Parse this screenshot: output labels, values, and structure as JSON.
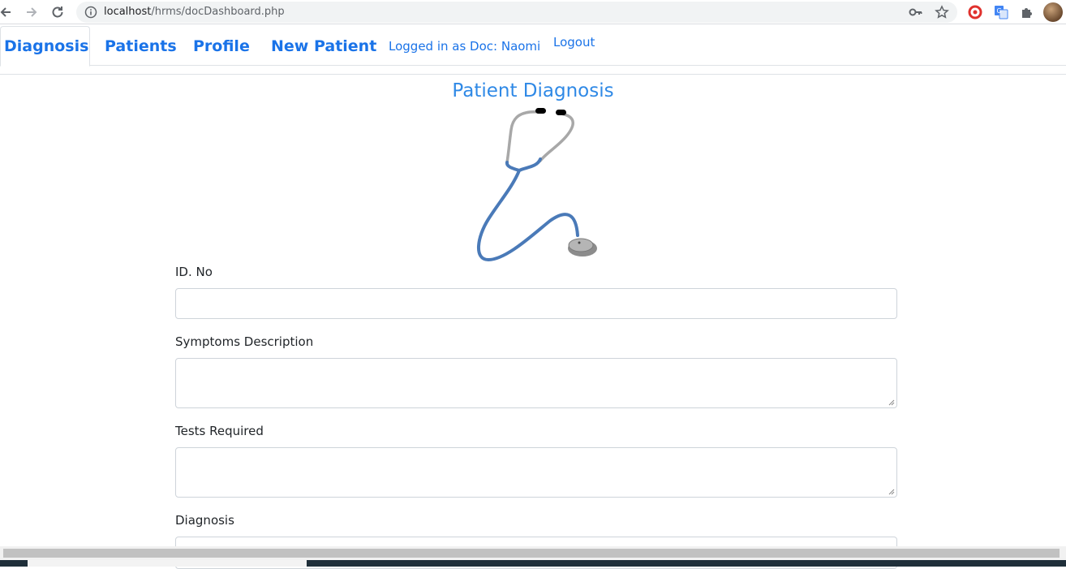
{
  "browser": {
    "url_host": "localhost",
    "url_path": "/hrms/docDashboard.php",
    "icons": [
      "back-arrow-icon",
      "forward-arrow-icon",
      "reload-icon",
      "info-icon",
      "key-icon",
      "star-icon",
      "grammarly-icon",
      "translate-icon",
      "puzzle-icon",
      "avatar"
    ]
  },
  "nav": {
    "tabs": [
      "Diagnosis",
      "Patients",
      "Profile",
      "New Patient"
    ],
    "active_tab": "Diagnosis",
    "logged_in_text": "Logged in as Doc: Naomi",
    "logout_label": "Logout",
    "link_color": "#1a73e8"
  },
  "page": {
    "title": "Patient Diagnosis",
    "image": "stethoscope-icon"
  },
  "form": {
    "id_label": "ID. No",
    "id_value": "",
    "symptoms_label": "Symptoms Description",
    "symptoms_value": "",
    "tests_label": "Tests Required",
    "tests_value": "",
    "diagnosis_label": "Diagnosis",
    "diagnosis_value": ""
  }
}
